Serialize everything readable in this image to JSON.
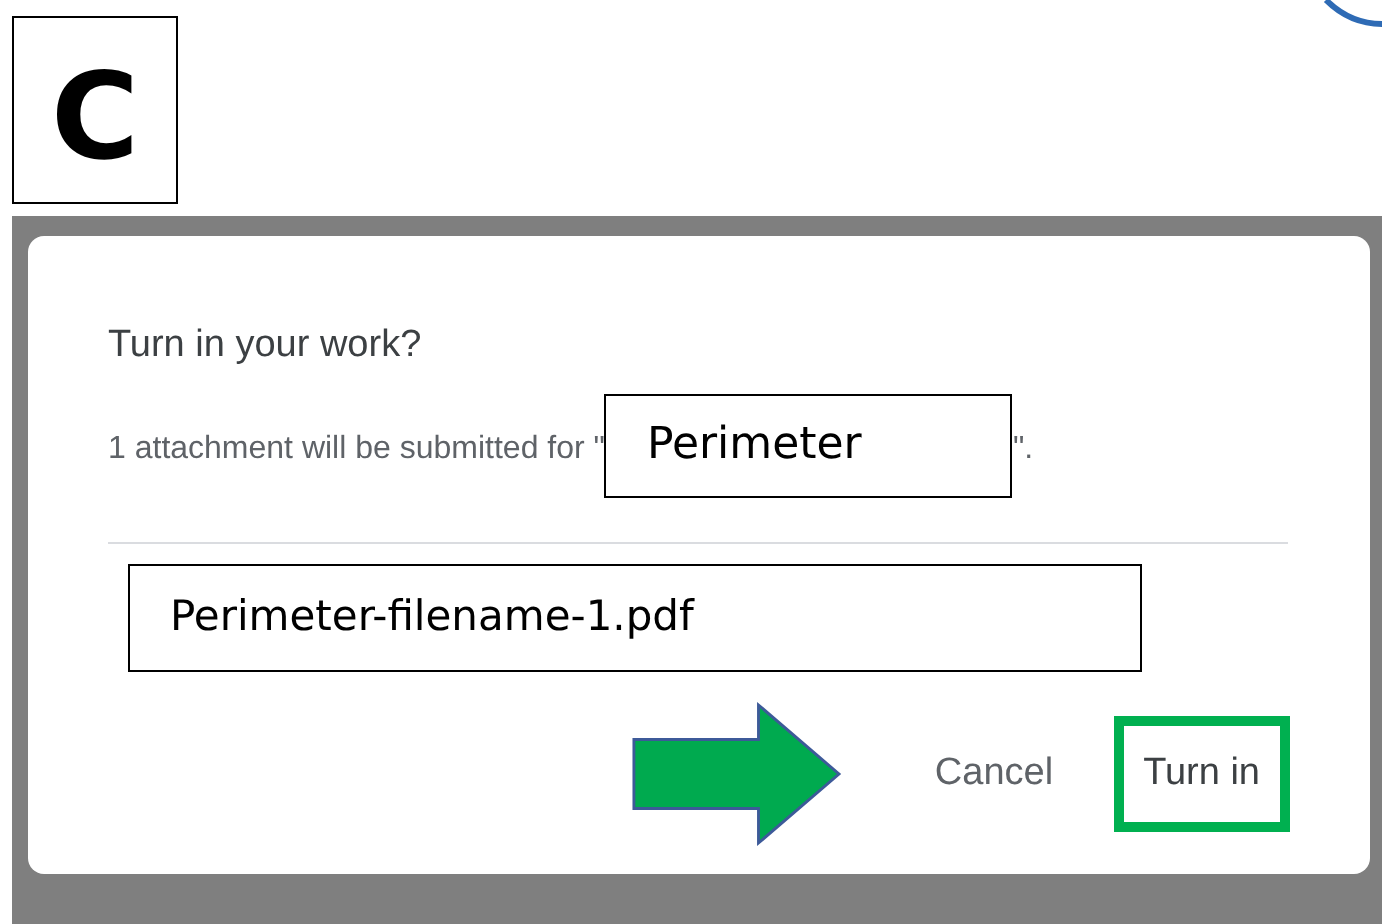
{
  "panel_label": "C",
  "dialog": {
    "title": "Turn in your work?",
    "message_prefix": "1 attachment will be submitted for \"",
    "assignment_name": "Perimeter",
    "message_suffix": "\".",
    "attachment": "Perimeter-filename-1.pdf",
    "buttons": [
      {
        "label": "Cancel",
        "highlighted": false
      },
      {
        "label": "Turn in",
        "highlighted": true
      }
    ]
  }
}
